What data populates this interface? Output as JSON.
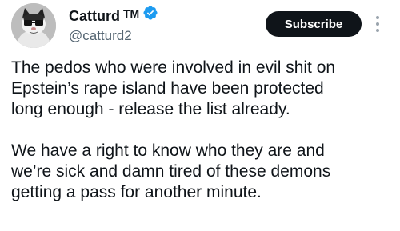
{
  "author": {
    "display_name": "Catturd",
    "trademark": "TM",
    "handle": "@catturd2",
    "verified_icon": "verified-badge-icon",
    "verified_color": "#1d9bf0"
  },
  "actions": {
    "subscribe_label": "Subscribe",
    "more_icon": "more-options-icon"
  },
  "tweet": {
    "paragraphs": [
      "The pedos who were involved in evil shit on\nEpstein’s rape island have been protected\nlong enough - release the list already.",
      "We have a right to know who they are and\nwe’re sick and damn tired of these demons\ngetting a pass for another minute."
    ]
  }
}
